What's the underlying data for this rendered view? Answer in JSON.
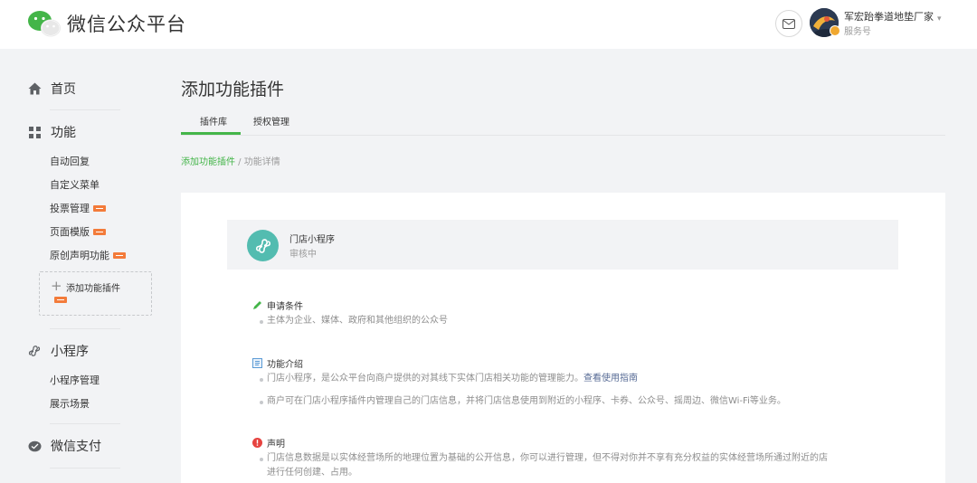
{
  "header": {
    "brand": "微信公众平台",
    "account_name": "军宏跆拳道地垫厂家",
    "account_type": "服务号"
  },
  "sidebar": {
    "sections": [
      {
        "label": "首页",
        "icon": "home-icon"
      },
      {
        "label": "功能",
        "icon": "grid-icon",
        "items": [
          {
            "label": "自动回复"
          },
          {
            "label": "自定义菜单"
          },
          {
            "label": "投票管理"
          },
          {
            "label": "页面模版"
          },
          {
            "label": "原创声明功能"
          }
        ],
        "add_label": "添加功能插件"
      },
      {
        "label": "小程序",
        "icon": "mini-program-icon",
        "items": [
          {
            "label": "小程序管理"
          },
          {
            "label": "展示场景"
          }
        ]
      },
      {
        "label": "微信支付",
        "icon": "wechat-pay-icon"
      }
    ]
  },
  "main": {
    "title": "添加功能插件",
    "tabs": [
      {
        "label": "插件库"
      },
      {
        "label": "授权管理"
      }
    ],
    "breadcrumb": {
      "link": "添加功能插件",
      "separator": " / ",
      "current": "功能详情"
    },
    "plugin": {
      "name": "门店小程序",
      "status": "审核中"
    },
    "sections": [
      {
        "title": "申请条件",
        "icon": "pen-icon",
        "bullets": [
          "主体为企业、媒体、政府和其他组织的公众号"
        ]
      },
      {
        "title": "功能介绍",
        "icon": "doc-icon",
        "bullets": [
          "门店小程序，是公众平台向商户提供的对其线下实体门店相关功能的管理能力。",
          "商户可在门店小程序插件内管理自己的门店信息，并将门店信息使用到附近的小程序、卡券、公众号、摇周边、微信Wi-Fi等业务。"
        ],
        "link": "查看使用指南"
      },
      {
        "title": "声明",
        "icon": "warning-icon",
        "bullets": [
          "门店信息数据是以实体经营场所的地理位置为基础的公开信息，你可以进行管理，但不得对你并不享有充分权益的实体经营场所通过附近的店",
          "进行任何创建、占用。"
        ]
      }
    ]
  },
  "colors": {
    "accent": "#44b549",
    "link": "#576b95",
    "plugin_icon_bg": "#53bcb0",
    "new_tag": "#f37b3a",
    "warning": "#e64340"
  }
}
